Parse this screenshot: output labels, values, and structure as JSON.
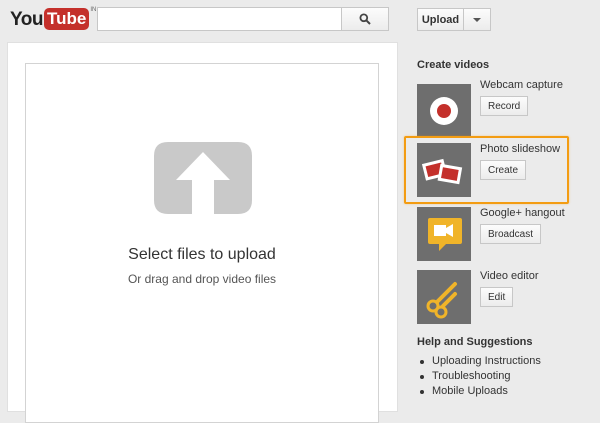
{
  "header": {
    "logo_you": "You",
    "logo_tube": "Tube",
    "logo_suffix": "IN",
    "search_placeholder": "",
    "upload_label": "Upload"
  },
  "main": {
    "select_title": "Select files to upload",
    "drag_text": "Or drag and drop video files"
  },
  "sidebar": {
    "create_header": "Create videos",
    "items": [
      {
        "title": "Webcam capture",
        "button": "Record",
        "icon": "record-icon"
      },
      {
        "title": "Photo slideshow",
        "button": "Create",
        "icon": "photo-slideshow-icon"
      },
      {
        "title": "Google+ hangout",
        "button": "Broadcast",
        "icon": "hangout-camera-icon"
      },
      {
        "title": "Video editor",
        "button": "Edit",
        "icon": "scissors-icon"
      }
    ],
    "help_header": "Help and Suggestions",
    "help_links": [
      "Uploading Instructions",
      "Troubleshooting",
      "Mobile Uploads"
    ]
  },
  "colors": {
    "brand_red": "#c4302b",
    "highlight_orange": "#f39c12",
    "hangout_yellow": "#f0b429"
  }
}
